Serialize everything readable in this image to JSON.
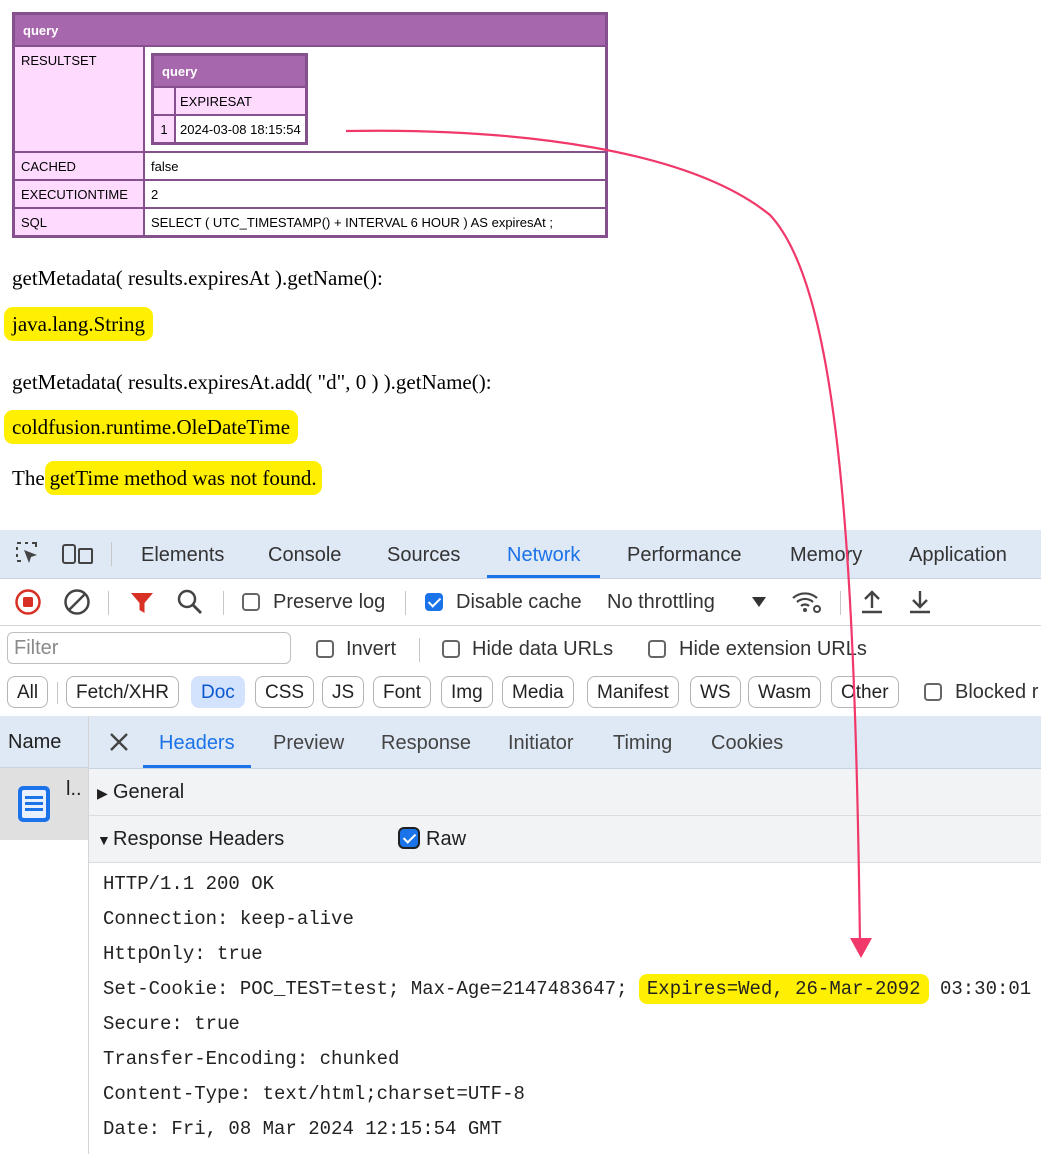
{
  "dump": {
    "title": "query",
    "rows": {
      "resultset_key": "RESULTSET",
      "cached_key": "CACHED",
      "cached_val": "false",
      "exectime_key": "EXECUTIONTIME",
      "exectime_val": "2",
      "sql_key": "SQL",
      "sql_val": "SELECT ( UTC_TIMESTAMP() + INTERVAL 6 HOUR ) AS expiresAt ;"
    },
    "inner": {
      "title": "query",
      "column": "EXPIRESAT",
      "row_num": "1",
      "row_val": "2024-03-08 18:15:54"
    }
  },
  "output": {
    "line1": "getMetadata( results.expiresAt ).getName():",
    "line2": "java.lang.String",
    "line3": "getMetadata( results.expiresAt.add( \"d\", 0 ) ).getName():",
    "line4": "coldfusion.runtime.OleDateTime",
    "line5_prefix": "The",
    "line5_hl": "getTime method was not found."
  },
  "devtools": {
    "tabs": [
      "Elements",
      "Console",
      "Sources",
      "Network",
      "Performance",
      "Memory",
      "Application"
    ],
    "toolbar": {
      "preserve_log": "Preserve log",
      "disable_cache": "Disable cache",
      "throttling": "No throttling"
    },
    "filter": {
      "placeholder": "Filter",
      "invert": "Invert",
      "hide_data": "Hide data URLs",
      "hide_ext": "Hide extension URLs"
    },
    "types": [
      "All",
      "Fetch/XHR",
      "Doc",
      "CSS",
      "JS",
      "Font",
      "Img",
      "Media",
      "Manifest",
      "WS",
      "Wasm",
      "Other"
    ],
    "blocked": "Blocked r",
    "name_header": "Name",
    "request_name": "l..",
    "detail_tabs": [
      "Headers",
      "Preview",
      "Response",
      "Initiator",
      "Timing",
      "Cookies"
    ],
    "general": "General",
    "response_headers": "Response Headers",
    "raw": "Raw",
    "headers": {
      "status": "HTTP/1.1 200 OK",
      "connection": "Connection: keep-alive",
      "httponly": "HttpOnly: true",
      "cookie_prefix": "Set-Cookie: POC_TEST=test; Max-Age=2147483647;",
      "cookie_expires": "Expires=Wed, 26-Mar-2092",
      "cookie_suffix": "03:30:01",
      "secure": "Secure: true",
      "transfer": "Transfer-Encoding: chunked",
      "content_type": "Content-Type: text/html;charset=UTF-8",
      "date": "Date: Fri, 08 Mar 2024 12:15:54 GMT"
    }
  },
  "colors": {
    "dump_header": "#a767ad",
    "dump_border": "#86508f",
    "dump_key": "#ffdaff",
    "highlight": "#ffef00",
    "accent": "#1a73e8",
    "arrow": "#f0386a"
  }
}
